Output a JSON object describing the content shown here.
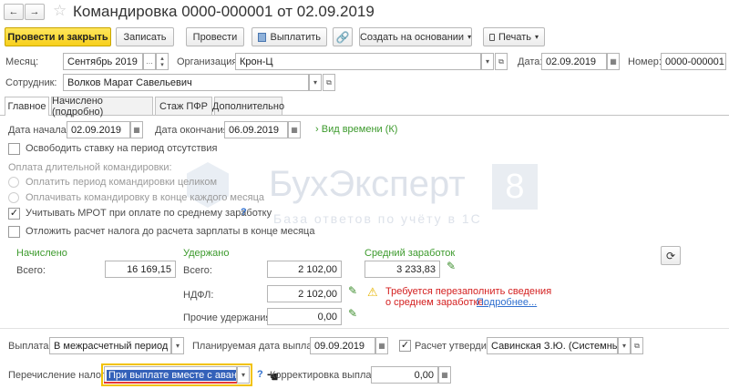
{
  "window": {
    "title": "Командировка 0000-000001 от 02.09.2019"
  },
  "toolbar": {
    "post_close": "Провести и закрыть",
    "save": "Записать",
    "post": "Провести",
    "pay": "Выплатить",
    "create_based": "Создать на основании",
    "print": "Печать"
  },
  "header": {
    "month_label": "Месяц:",
    "month_value": "Сентябрь 2019",
    "org_label": "Организация:",
    "org_value": "Крон-Ц",
    "date_label": "Дата:",
    "date_value": "02.09.2019",
    "number_label": "Номер:",
    "number_value": "0000-000001",
    "employee_label": "Сотрудник:",
    "employee_value": "Волков Марат Савельевич"
  },
  "tabs": [
    "Главное",
    "Начислено (подробно)",
    "Стаж ПФР",
    "Дополнительно"
  ],
  "main": {
    "start_label": "Дата начала:",
    "start_value": "02.09.2019",
    "end_label": "Дата окончания:",
    "end_value": "06.09.2019",
    "time_kind": "Вид времени (К)",
    "release_rate": "Освободить ставку на период отсутствия",
    "long_trip_label": "Оплата длительной командировки:",
    "radio1": "Оплатить период командировки целиком",
    "radio2": "Оплачивать командировку в конце каждого месяца",
    "mrot": "Учитывать МРОТ при оплате по среднему заработку",
    "postpone": "Отложить расчет налога до расчета зарплаты в конце месяца",
    "accrued_header": "Начислено",
    "withheld_header": "Удержано",
    "avg_header": "Средний заработок",
    "total_label": "Всего:",
    "accrued_total": "16 169,15",
    "withheld_total_label": "Всего:",
    "withheld_total": "2 102,00",
    "ndfl_label": "НДФЛ:",
    "ndfl_value": "2 102,00",
    "other_label": "Прочие удержания:",
    "other_value": "0,00",
    "avg_value": "3 233,83",
    "warning_line1": "Требуется перезаполнить сведения",
    "warning_line2": "о среднем заработке.",
    "more_link": "Подробнее...",
    "payout_label": "Выплата:",
    "payout_value": "В межрасчетный период",
    "planned_label": "Планируемая дата выплаты:",
    "planned_value": "09.09.2019",
    "approved_label": "Расчет утвердил",
    "approved_value": "Савинская З.Ю. (Системный п",
    "tax_label": "Перечисление налога:",
    "tax_value": "При выплате вместе с авансом",
    "correction_label": "Корректировка выплаты:",
    "correction_value": "0,00"
  },
  "watermark": {
    "brand": "БухЭксперт",
    "number": "8",
    "tagline": "База ответов по учёту в 1С"
  },
  "colors": {
    "accent_yellow": "#f7cf1c",
    "link": "#2f6fcf",
    "green": "#3c9a2c",
    "warning": "#d42020"
  }
}
